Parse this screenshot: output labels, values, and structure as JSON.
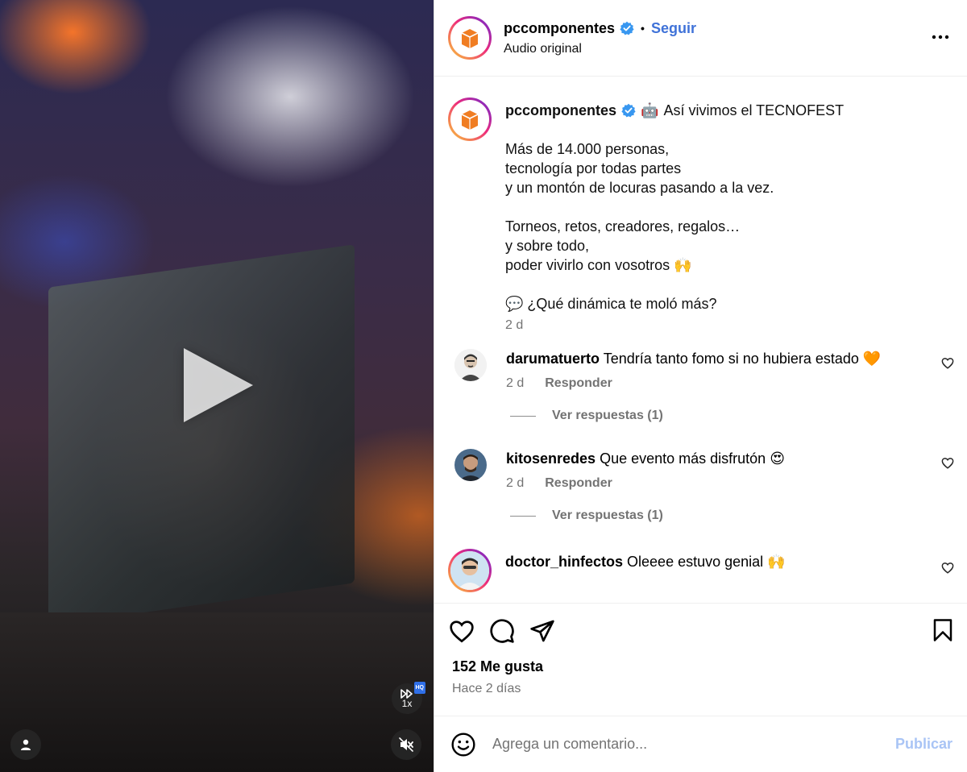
{
  "header": {
    "username": "pccomponentes",
    "follow_label": "Seguir",
    "dot": "•",
    "audio_label": "Audio original"
  },
  "caption": {
    "username": "pccomponentes",
    "emoji": "🤖",
    "title": "Así vivimos el TECNOFEST",
    "paragraph1": "Más de 14.000 personas,\ntecnología por todas partes\ny un montón de locuras pasando a la vez.",
    "paragraph2": "Torneos, retos, creadores, regalos…\ny sobre todo,\npoder vivirlo con vosotros 🙌",
    "paragraph3": "💬 ¿Qué dinámica te moló más?",
    "time": "2 d"
  },
  "comments": [
    {
      "username": "darumatuerto",
      "text": "Tendría tanto fomo si no hubiera estado 🧡",
      "time": "2 d",
      "reply_label": "Responder",
      "replies_label": "Ver respuestas (1)"
    },
    {
      "username": "kitosenredes",
      "text": "Que evento más disfrutón 😍",
      "time": "2 d",
      "reply_label": "Responder",
      "replies_label": "Ver respuestas (1)"
    },
    {
      "username": "doctor_hinfectos",
      "text": "Oleeee estuvo genial 🙌"
    }
  ],
  "stats": {
    "likes": "152 Me gusta",
    "posted": "Hace 2 días"
  },
  "composer": {
    "placeholder": "Agrega un comentario...",
    "publish_label": "Publicar"
  },
  "video": {
    "speed_label": "1x",
    "hq_label": "HQ"
  },
  "colors": {
    "link_blue": "#3f72d8",
    "verified_blue": "#3897f0",
    "publish_disabled": "#a9c4f5",
    "brand_orange": "#f07d22"
  },
  "icons": [
    "play-icon",
    "speed-icon",
    "user-tag-icon",
    "mute-icon",
    "verified-icon",
    "more-icon",
    "heart-icon",
    "comment-icon",
    "share-icon",
    "bookmark-icon",
    "emoji-icon"
  ]
}
